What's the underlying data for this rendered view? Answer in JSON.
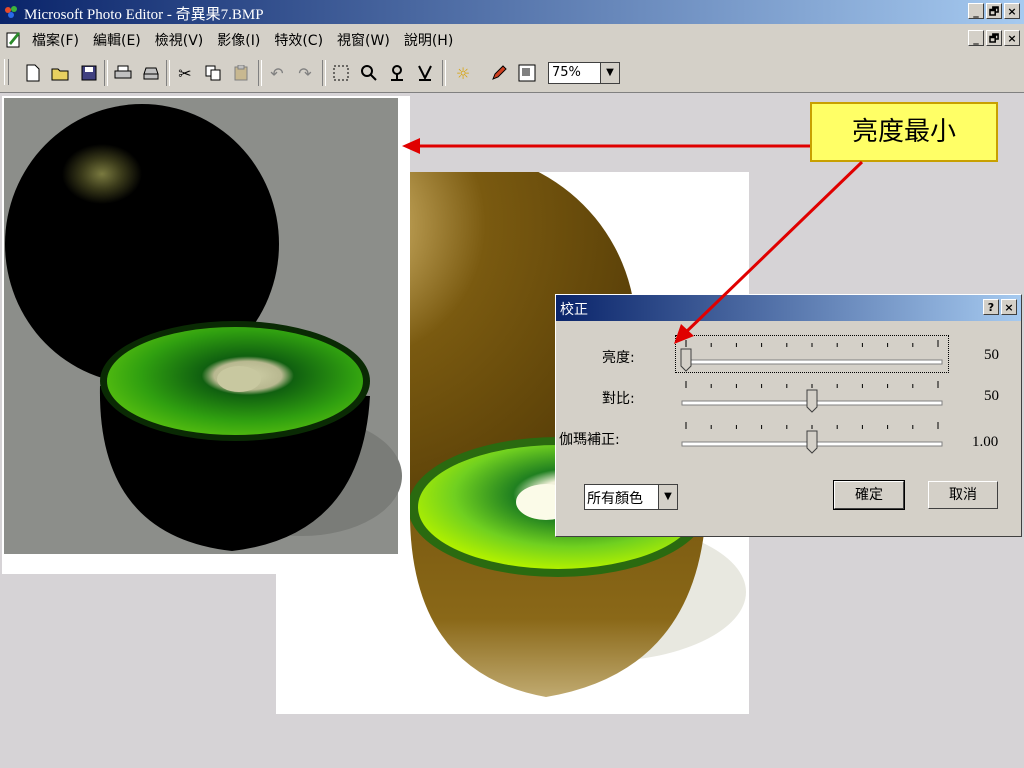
{
  "window": {
    "title": "Microsoft Photo Editor - 奇異果7.BMP",
    "buttons": [
      "_",
      "🗗",
      "×"
    ]
  },
  "menubar": {
    "items": [
      "檔案(F)",
      "編輯(E)",
      "檢視(V)",
      "影像(I)",
      "特效(C)",
      "視窗(W)",
      "說明(H)"
    ],
    "buttons": [
      "_",
      "🗗",
      "×"
    ]
  },
  "toolbar": {
    "icons": [
      "new-file-icon",
      "open-folder-icon",
      "save-icon",
      "print-icon",
      "scan-icon",
      "cut-icon",
      "copy-icon",
      "paste-icon",
      "undo-icon",
      "redo-icon",
      "select-icon",
      "zoom-icon",
      "smudge-icon",
      "sharpen-icon",
      "balance-icon",
      "pen-icon",
      "resize-icon"
    ],
    "zoom_value": "75%"
  },
  "callout": {
    "text": "亮度最小"
  },
  "dialog": {
    "title": "校正",
    "help_button": "?",
    "close_button": "×",
    "rows": [
      {
        "label": "亮度:",
        "value": "50",
        "level": 0
      },
      {
        "label": "對比:",
        "value": "50",
        "level": 0.5
      },
      {
        "label": "伽瑪補正:",
        "value": "1.00",
        "level": 0.5
      }
    ],
    "color_select": "所有顏色",
    "ok_label": "確定",
    "cancel_label": "取消"
  },
  "colors": {
    "titlebar_start": "#0a246a",
    "titlebar_end": "#a6caf0",
    "callout_bg": "#ffff66",
    "arrow": "#e00000"
  }
}
